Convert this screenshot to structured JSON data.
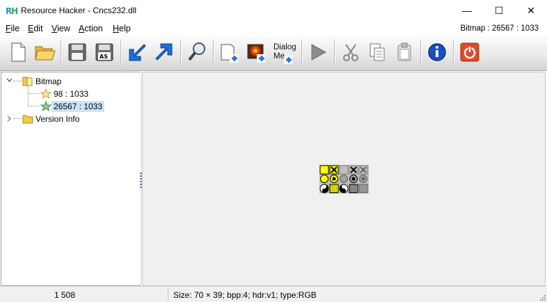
{
  "window": {
    "title": "Resource Hacker - Cncs232.dll",
    "minimize_glyph": "—",
    "maximize_glyph": "☐",
    "close_glyph": "✕"
  },
  "menu": {
    "file": {
      "accel": "F",
      "rest": "ile"
    },
    "edit": {
      "accel": "E",
      "rest": "dit"
    },
    "view": {
      "accel": "V",
      "rest": "iew"
    },
    "action": {
      "accel": "A",
      "rest": "ction"
    },
    "help": {
      "accel": "H",
      "rest": "elp"
    }
  },
  "current_resource": "Bitmap : 26567 : 1033",
  "toolbar": {
    "dialog_line1": "Dialog",
    "dialog_line2": "Me",
    "icons": [
      "new-file-icon",
      "open-folder-icon",
      "save-icon",
      "save-as-icon",
      "compile-import-icon",
      "export-icon",
      "find-icon",
      "add-image-resource-icon",
      "add-bitmap-icon",
      "dialog-merger-icon",
      "run-script-icon",
      "cut-icon",
      "copy-icon",
      "paste-icon",
      "info-icon",
      "exit-icon"
    ]
  },
  "tree": {
    "root": {
      "label": "Bitmap",
      "expanded": true
    },
    "children": [
      {
        "label": "98 : 1033",
        "selected": false
      },
      {
        "label": "26567 : 1033",
        "selected": true
      }
    ],
    "sibling": {
      "label": "Version Info",
      "expanded": false
    }
  },
  "status": {
    "left": "1 508",
    "right": "Size: 70 × 39;  bpp:4;  hdr:v1;  type:RGB"
  },
  "colors": {
    "selection": "#cce4f7",
    "toolbar_blue": "#1e6fd9",
    "info_blue": "#1a4fc2",
    "exit_red": "#e04a2a",
    "bitmap_yellow": "#ffff00"
  }
}
